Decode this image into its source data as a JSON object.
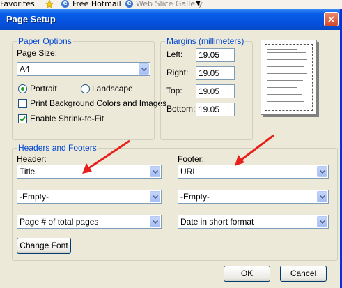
{
  "browser": {
    "favorites_label": "Favorites",
    "links": [
      "Free Hotmail",
      "Web Slice Gallery"
    ]
  },
  "dialog": {
    "title": "Page Setup",
    "close_glyph": "×"
  },
  "paper_options": {
    "legend": "Paper Options",
    "page_size_label": "Page Size:",
    "page_size_value": "A4",
    "portrait_label": "Portrait",
    "landscape_label": "Landscape",
    "orientation_selected": "Portrait",
    "print_bg_label": "Print Background Colors and Images",
    "print_bg_checked": false,
    "shrink_label": "Enable Shrink-to-Fit",
    "shrink_checked": true
  },
  "margins": {
    "legend": "Margins (millimeters)",
    "left_label": "Left:",
    "left_value": "19.05",
    "right_label": "Right:",
    "right_value": "19.05",
    "top_label": "Top:",
    "top_value": "19.05",
    "bottom_label": "Bottom:",
    "bottom_value": "19.05"
  },
  "headers_footers": {
    "legend": "Headers and Footers",
    "header_label": "Header:",
    "footer_label": "Footer:",
    "header_rows": [
      "Title",
      "-Empty-",
      "Page # of total pages"
    ],
    "footer_rows": [
      "URL",
      "-Empty-",
      "Date in short format"
    ],
    "change_font_label": "Change Font"
  },
  "buttons": {
    "ok_label": "OK",
    "cancel_label": "Cancel"
  },
  "colors": {
    "titlebar": "#0553e0",
    "legend_text": "#0046d5",
    "annotation_arrow": "#e8201c"
  },
  "annotations": {
    "arrows_point_to": [
      "header-select-1",
      "footer-select-1"
    ]
  }
}
